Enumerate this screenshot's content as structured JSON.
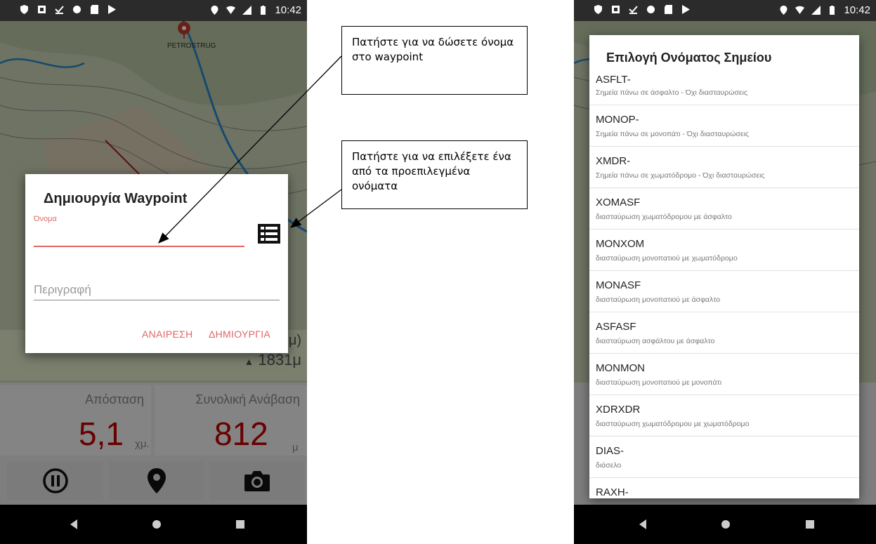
{
  "status_bar": {
    "time": "10:42"
  },
  "left": {
    "map": {
      "place_label": "PETROSTRUG"
    },
    "dialog": {
      "title": "Δημιουργία Waypoint",
      "name_label": "Όνομα",
      "name_value": "",
      "description_placeholder": "Περιγραφή",
      "cancel_label": "ΑΝΑΙΡΕΣΗ",
      "create_label": "ΔΗΜΙΟΥΡΓΙΑ"
    },
    "elevation": {
      "value": "1831μ",
      "partial_above": "μ)"
    },
    "stats": {
      "distance_label": "Απόσταση",
      "distance_value": "5,1",
      "distance_unit": "χμ.",
      "ascent_label": "Συνολική Ανάβαση",
      "ascent_value": "812",
      "ascent_unit": "μ"
    },
    "controls": [
      "pause-icon",
      "location-pin-icon",
      "camera-icon"
    ]
  },
  "callouts": {
    "name": "Πατήστε για να δώσετε όνομα στο waypoint",
    "select": "Πατήστε για να επιλέξετε ένα από τα προεπιλεγμένα ονόματα"
  },
  "right": {
    "dialog": {
      "title": "Επιλογή Ονόματος Σημείου",
      "items": [
        {
          "code": "ASFLT-",
          "desc": "Σημεία πάνω σε άσφαλτο - Όχι διασταυρώσεις"
        },
        {
          "code": "MONOP-",
          "desc": "Σημεία πάνω σε μονοπάτι - Όχι διασταυρώσεις"
        },
        {
          "code": "XMDR-",
          "desc": "Σημεία πάνω σε χωματόδρομο - Όχι διασταυρώσεις"
        },
        {
          "code": "XOMASF",
          "desc": "διασταύρωση χωματόδρομου με άσφαλτο"
        },
        {
          "code": "MONXOM",
          "desc": "διασταύρωση μονοπατιού με χωματόδρομο"
        },
        {
          "code": "MONASF",
          "desc": "διασταύρωση μονοπατιού με άσφαλτο"
        },
        {
          "code": "ASFASF",
          "desc": "διασταύρωση ασφάλτου με άσφαλτο"
        },
        {
          "code": "MONMON",
          "desc": "διασταύρωση μονοπατιού με μονοπάτι"
        },
        {
          "code": "XDRXDR",
          "desc": "διασταύρωση χωματόδρομου με χωματόδρομο"
        },
        {
          "code": "DIAS-",
          "desc": "διάσελο"
        },
        {
          "code": "RAXH-",
          "desc": ""
        }
      ]
    }
  },
  "colors": {
    "accent": "#e06666",
    "stat_value": "#c00000",
    "statusbar": "#2b2b2b"
  }
}
